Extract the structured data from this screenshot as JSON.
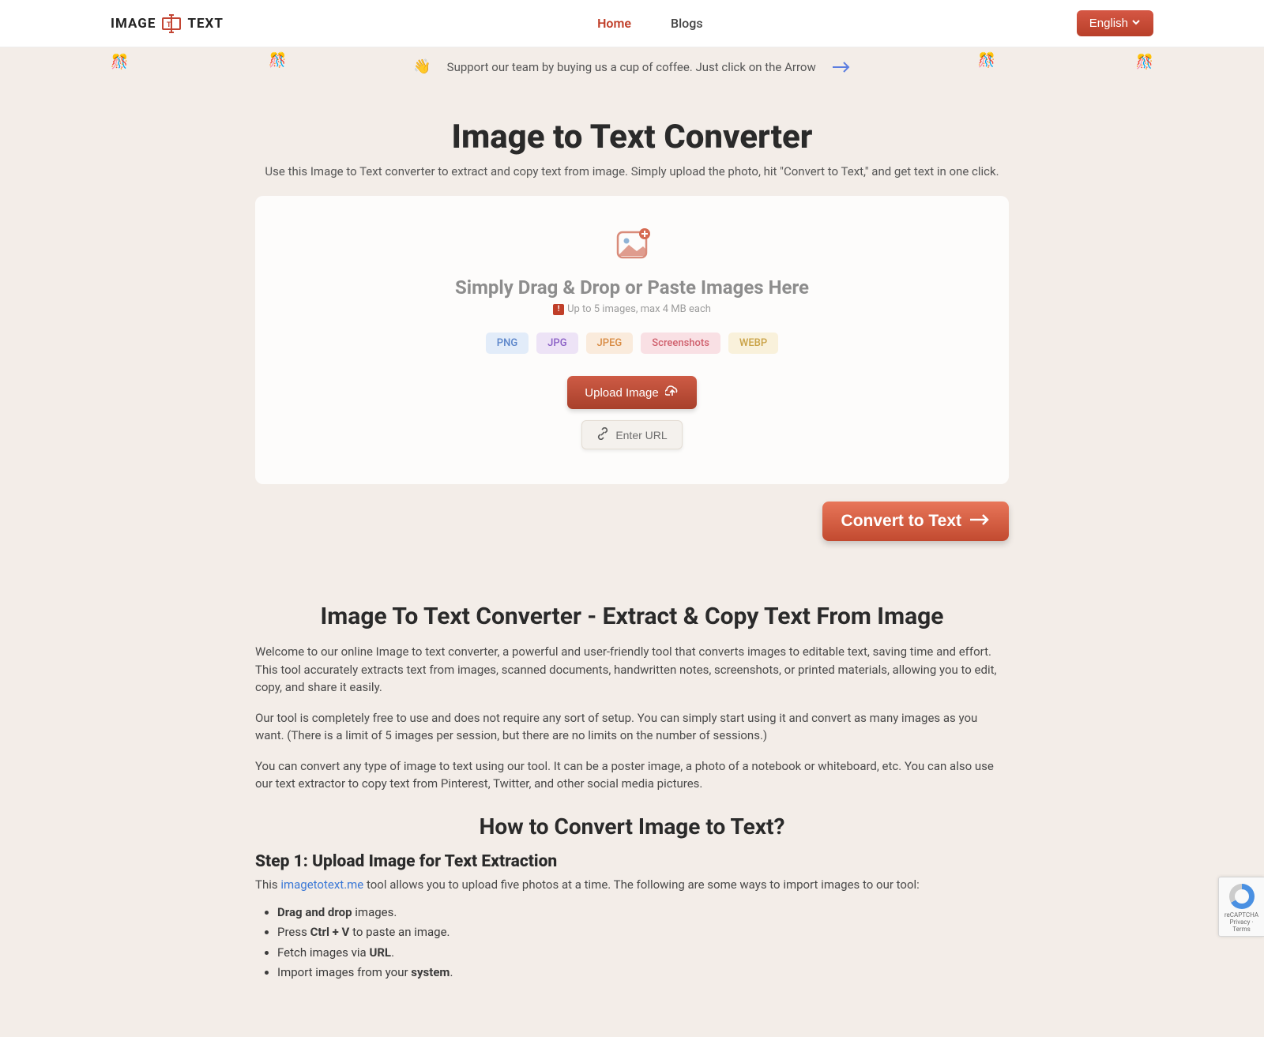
{
  "header": {
    "logo_left": "IMAGE",
    "logo_right": "TEXT",
    "nav": [
      {
        "label": "Home",
        "active": true
      },
      {
        "label": "Blogs",
        "active": false
      }
    ],
    "language": "English"
  },
  "banner": {
    "text": "Support our team by buying us a cup of coffee. Just click on the Arrow"
  },
  "hero": {
    "title": "Image to Text Converter",
    "subtitle": "Use this Image to Text converter to extract and copy text from image. Simply upload the photo, hit \"Convert to Text,\" and get text in one click."
  },
  "dropzone": {
    "title": "Simply Drag & Drop or Paste Images Here",
    "limit": "Up to 5 images, max 4 MB each",
    "chips": [
      "PNG",
      "JPG",
      "JPEG",
      "Screenshots",
      "WEBP"
    ],
    "upload_label": "Upload Image",
    "url_label": "Enter URL"
  },
  "convert_label": "Convert to Text",
  "info": {
    "title": "Image To Text Converter - Extract & Copy Text From Image",
    "p1": "Welcome to our online Image to text converter, a powerful and user-friendly tool that converts images to editable text, saving time and effort. This tool accurately extracts text from images, scanned documents, handwritten notes, screenshots, or printed materials, allowing you to edit, copy, and share it easily.",
    "p2": "Our tool is completely free to use and does not require any sort of setup. You can simply start using it and convert as many images as you want. (There is a limit of 5 images per session, but there are no limits on the number of sessions.)",
    "p3": "You can convert any type of image to text using our tool. It can be a poster image, a photo of a notebook or whiteboard, etc. You can also use our text extractor to copy text from Pinterest, Twitter, and other social media pictures.",
    "how_title": "How to Convert Image to Text?",
    "step1_title": "Step 1: Upload Image for Text Extraction",
    "step1_prefix": "This ",
    "step1_link": "imagetotext.me",
    "step1_suffix": " tool allows you to upload five photos at a time. The following are some ways to import images to our tool:",
    "bullets": [
      {
        "b": "Drag and drop",
        "rest": " images."
      },
      {
        "pre": "Press ",
        "b": "Ctrl + V",
        "rest": " to paste an image."
      },
      {
        "pre": "Fetch images via ",
        "b": "URL",
        "rest": "."
      },
      {
        "pre": "Import images from your ",
        "b": "system",
        "rest": "."
      }
    ]
  },
  "recaptcha": {
    "brand": "reCAPTCHA",
    "privacy": "Privacy",
    "terms": "Terms"
  }
}
